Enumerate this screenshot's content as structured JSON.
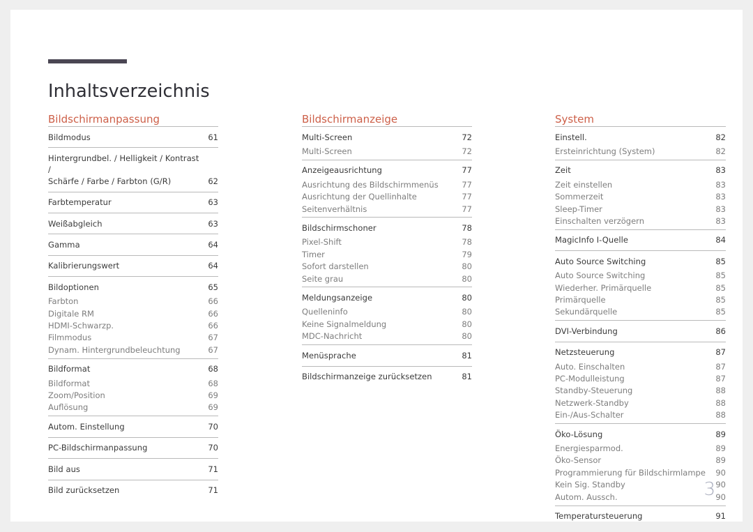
{
  "document": {
    "title": "Inhaltsverzeichnis",
    "folio": "3",
    "accent_color": "#cd6049",
    "rule_color": "#4a4653",
    "folio_color": "#a9adbd"
  },
  "columns": [
    {
      "heading": "Bildschirmanpassung",
      "groups": [
        {
          "entries": [
            {
              "level": 1,
              "label": "Bildmodus",
              "page": "61"
            }
          ]
        },
        {
          "entries": [
            {
              "level": 1,
              "label": "Hintergrundbel. / Helligkeit / Kontrast /",
              "label2": "Schärfe / Farbe / Farbton (G/R)",
              "page": "62"
            }
          ]
        },
        {
          "entries": [
            {
              "level": 1,
              "label": "Farbtemperatur",
              "page": "63"
            }
          ]
        },
        {
          "entries": [
            {
              "level": 1,
              "label": "Weißabgleich",
              "page": "63"
            }
          ]
        },
        {
          "entries": [
            {
              "level": 1,
              "label": "Gamma",
              "page": "64"
            }
          ]
        },
        {
          "entries": [
            {
              "level": 1,
              "label": "Kalibrierungswert",
              "page": "64"
            }
          ]
        },
        {
          "entries": [
            {
              "level": 1,
              "label": "Bildoptionen",
              "page": "65"
            },
            {
              "level": 2,
              "label": "Farbton",
              "page": "66"
            },
            {
              "level": 2,
              "label": "Digitale RM",
              "page": "66"
            },
            {
              "level": 2,
              "label": "HDMI-Schwarzp.",
              "page": "66"
            },
            {
              "level": 2,
              "label": "Filmmodus",
              "page": "67"
            },
            {
              "level": 2,
              "label": "Dynam. Hintergrundbeleuchtung",
              "page": "67"
            }
          ]
        },
        {
          "entries": [
            {
              "level": 1,
              "label": "Bildformat",
              "page": "68"
            },
            {
              "level": 2,
              "label": "Bildformat",
              "page": "68"
            },
            {
              "level": 2,
              "label": "Zoom/Position",
              "page": "69"
            },
            {
              "level": 2,
              "label": "Auflösung",
              "page": "69"
            }
          ]
        },
        {
          "entries": [
            {
              "level": 1,
              "label": "Autom. Einstellung",
              "page": "70"
            }
          ]
        },
        {
          "entries": [
            {
              "level": 1,
              "label": "PC-Bildschirmanpassung",
              "page": "70"
            }
          ]
        },
        {
          "entries": [
            {
              "level": 1,
              "label": "Bild aus",
              "page": "71"
            }
          ]
        },
        {
          "entries": [
            {
              "level": 1,
              "label": "Bild zurücksetzen",
              "page": "71"
            }
          ]
        }
      ]
    },
    {
      "heading": "Bildschirmanzeige",
      "groups": [
        {
          "entries": [
            {
              "level": 1,
              "label": "Multi-Screen",
              "page": "72"
            },
            {
              "level": 2,
              "label": "Multi-Screen",
              "page": "72"
            }
          ]
        },
        {
          "entries": [
            {
              "level": 1,
              "label": "Anzeigeausrichtung",
              "page": "77"
            },
            {
              "level": 2,
              "label": "Ausrichtung des Bildschirmmenüs",
              "page": "77"
            },
            {
              "level": 2,
              "label": "Ausrichtung der Quellinhalte",
              "page": "77"
            },
            {
              "level": 2,
              "label": "Seitenverhältnis",
              "page": "77"
            }
          ]
        },
        {
          "entries": [
            {
              "level": 1,
              "label": "Bildschirmschoner",
              "page": "78"
            },
            {
              "level": 2,
              "label": "Pixel-Shift",
              "page": "78"
            },
            {
              "level": 2,
              "label": "Timer",
              "page": "79"
            },
            {
              "level": 2,
              "label": "Sofort darstellen",
              "page": "80"
            },
            {
              "level": 2,
              "label": "Seite grau",
              "page": "80"
            }
          ]
        },
        {
          "entries": [
            {
              "level": 1,
              "label": "Meldungsanzeige",
              "page": "80"
            },
            {
              "level": 2,
              "label": "Quelleninfo",
              "page": "80"
            },
            {
              "level": 2,
              "label": "Keine Signalmeldung",
              "page": "80"
            },
            {
              "level": 2,
              "label": "MDC-Nachricht",
              "page": "80"
            }
          ]
        },
        {
          "entries": [
            {
              "level": 1,
              "label": "Menüsprache",
              "page": "81"
            }
          ]
        },
        {
          "entries": [
            {
              "level": 1,
              "label": "Bildschirmanzeige zurücksetzen",
              "page": "81"
            }
          ]
        }
      ]
    },
    {
      "heading": "System",
      "groups": [
        {
          "entries": [
            {
              "level": 1,
              "label": "Einstell.",
              "page": "82"
            },
            {
              "level": 2,
              "label": "Ersteinrichtung (System)",
              "page": "82"
            }
          ]
        },
        {
          "entries": [
            {
              "level": 1,
              "label": "Zeit",
              "page": "83"
            },
            {
              "level": 2,
              "label": "Zeit einstellen",
              "page": "83"
            },
            {
              "level": 2,
              "label": "Sommerzeit",
              "page": "83"
            },
            {
              "level": 2,
              "label": "Sleep-Timer",
              "page": "83"
            },
            {
              "level": 2,
              "label": "Einschalten verzögern",
              "page": "83"
            }
          ]
        },
        {
          "entries": [
            {
              "level": 1,
              "label": "MagicInfo I-Quelle",
              "page": "84"
            }
          ]
        },
        {
          "entries": [
            {
              "level": 1,
              "label": "Auto Source Switching",
              "page": "85"
            },
            {
              "level": 2,
              "label": "Auto Source Switching",
              "page": "85"
            },
            {
              "level": 2,
              "label": "Wiederher. Primärquelle",
              "page": "85"
            },
            {
              "level": 2,
              "label": "Primärquelle",
              "page": "85"
            },
            {
              "level": 2,
              "label": "Sekundärquelle",
              "page": "85"
            }
          ]
        },
        {
          "entries": [
            {
              "level": 1,
              "label": "DVI-Verbindung",
              "page": "86"
            }
          ]
        },
        {
          "entries": [
            {
              "level": 1,
              "label": "Netzsteuerung",
              "page": "87"
            },
            {
              "level": 2,
              "label": "Auto. Einschalten",
              "page": "87"
            },
            {
              "level": 2,
              "label": "PC-Modulleistung",
              "page": "87"
            },
            {
              "level": 2,
              "label": "Standby-Steuerung",
              "page": "88"
            },
            {
              "level": 2,
              "label": "Netzwerk-Standby",
              "page": "88"
            },
            {
              "level": 2,
              "label": "Ein-/Aus-Schalter",
              "page": "88"
            }
          ]
        },
        {
          "entries": [
            {
              "level": 1,
              "label": "Öko-Lösung",
              "page": "89"
            },
            {
              "level": 2,
              "label": "Energiesparmod.",
              "page": "89"
            },
            {
              "level": 2,
              "label": "Öko-Sensor",
              "page": "89"
            },
            {
              "level": 2,
              "label": "Programmierung für Bildschirmlampe",
              "page": "90"
            },
            {
              "level": 2,
              "label": "Kein Sig. Standby",
              "page": "90"
            },
            {
              "level": 2,
              "label": "Autom. Aussch.",
              "page": "90"
            }
          ]
        },
        {
          "entries": [
            {
              "level": 1,
              "label": "Temperatursteuerung",
              "page": "91"
            }
          ]
        }
      ]
    }
  ]
}
